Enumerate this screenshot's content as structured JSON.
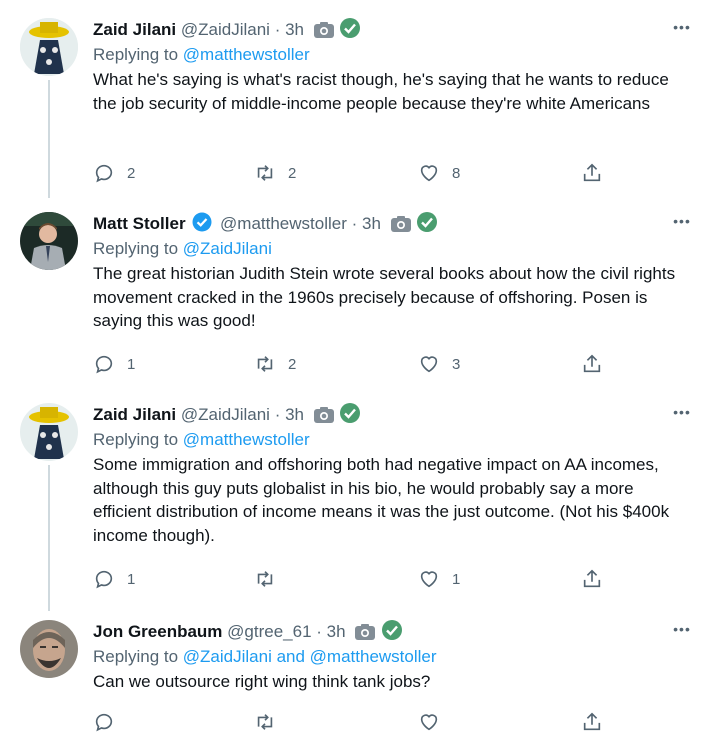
{
  "tweets": [
    {
      "name": "Zaid Jilani",
      "handle": "@ZaidJilani",
      "time": "· 3h",
      "verified_blue": false,
      "replying_prefix": "Replying to ",
      "replying_to": "@matthewstoller",
      "replying_to_2": "",
      "text": "What he's saying is what's racist though, he's saying that he wants to reduce the job security of middle-income people because they're white Americans",
      "replies": "2",
      "retweets": "2",
      "likes": "8"
    },
    {
      "name": "Matt Stoller",
      "handle": "@matthewstoller",
      "time": "· 3h",
      "verified_blue": true,
      "replying_prefix": "Replying to ",
      "replying_to": "@ZaidJilani",
      "replying_to_2": "",
      "text": "The great historian Judith Stein wrote several books about how the civil rights movement cracked in the 1960s precisely because of offshoring. Posen is saying this was good!",
      "replies": "1",
      "retweets": "2",
      "likes": "3"
    },
    {
      "name": "Zaid Jilani",
      "handle": "@ZaidJilani",
      "time": "· 3h",
      "verified_blue": false,
      "replying_prefix": "Replying to ",
      "replying_to": "@matthewstoller",
      "replying_to_2": "",
      "text": "Some immigration and offshoring both had negative impact on AA incomes, although this guy puts globalist in his bio, he would probably say a more efficient distribution of income means it was the just outcome. (Not his $400k income though).",
      "replies": "1",
      "retweets": "",
      "likes": "1"
    },
    {
      "name": "Jon Greenbaum",
      "handle": "@gtree_61",
      "time": "· 3h",
      "verified_blue": false,
      "replying_prefix": "Replying to ",
      "replying_to": "@ZaidJilani",
      "replying_to_2": " and @matthewstoller",
      "text": "Can we outsource right wing think tank jobs?",
      "replies": "",
      "retweets": "",
      "likes": ""
    }
  ],
  "more_label": "•••",
  "colors": {
    "link": "#1d9bf0",
    "muted": "#536471",
    "green_badge": "#4a9d6f",
    "verified": "#1d9bf0"
  },
  "icons": [
    "reply-icon",
    "retweet-icon",
    "like-icon",
    "share-icon",
    "camera-icon",
    "green-check-badge-icon",
    "verified-badge-icon"
  ]
}
